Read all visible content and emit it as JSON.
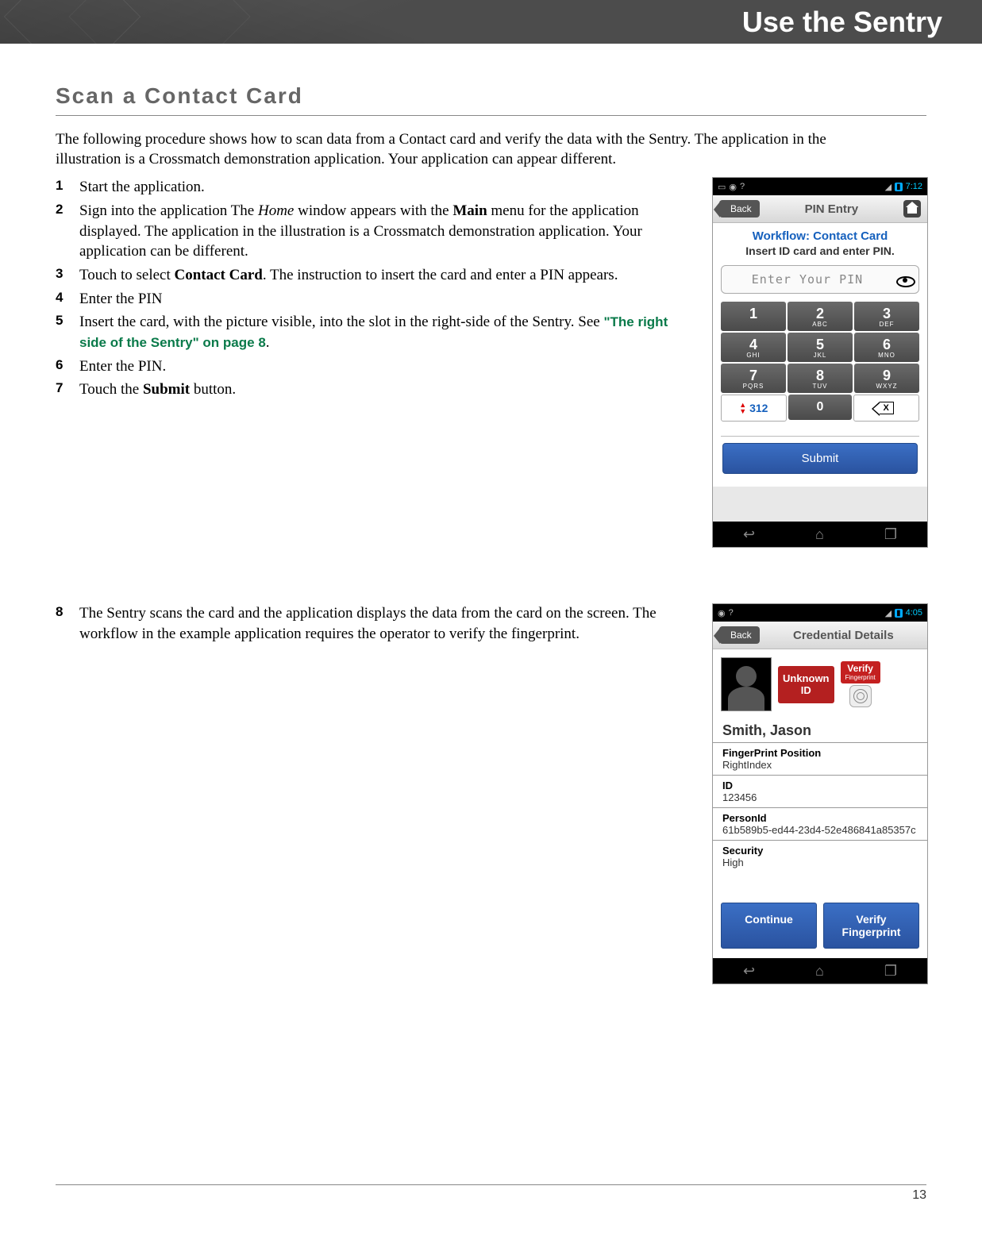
{
  "header": {
    "title": "Use the Sentry"
  },
  "section_title": "Scan a Contact Card",
  "intro": "The following procedure shows how to scan data from a Contact card and verify the data with the Sentry. The application in the illustration is a Crossmatch demonstration application. Your application can appear different.",
  "steps": {
    "s1": {
      "n": "1",
      "text": "Start the application."
    },
    "s2": {
      "n": "2",
      "pre": "Sign into the application The ",
      "home": "Home",
      "mid": " window appears with the ",
      "main": "Main",
      "post": " menu for the application displayed. The application in the illustration is a Crossmatch demonstration application. Your application can be different."
    },
    "s3": {
      "n": "3",
      "pre": "Touch to select ",
      "bold": "Contact Card",
      "post": ". The instruction to insert the card and enter a PIN appears."
    },
    "s4": {
      "n": "4",
      "text": "Enter the PIN"
    },
    "s5": {
      "n": "5",
      "pre": "Insert the card, with the picture visible, into the slot in the right-side of the Sentry. See ",
      "link": "\"The right side of the Sentry\" on page 8",
      "post": "."
    },
    "s6": {
      "n": "6",
      "text": "Enter the PIN."
    },
    "s7": {
      "n": "7",
      "pre": "Touch the ",
      "bold": "Submit",
      "post": " button."
    },
    "s8": {
      "n": "8",
      "text": "The Sentry scans the card and the application displays the data from the card on the screen. The workflow in the example application requires the operator to verify the fingerprint."
    }
  },
  "pin_screen": {
    "time": "7:12",
    "back": "Back",
    "title": "PIN Entry",
    "workflow": "Workflow: Contact Card",
    "instruction": "Insert ID card and enter PIN.",
    "placeholder": "Enter Your PIN",
    "keys": [
      {
        "d": "1",
        "l": ""
      },
      {
        "d": "2",
        "l": "ABC"
      },
      {
        "d": "3",
        "l": "DEF"
      },
      {
        "d": "4",
        "l": "GHI"
      },
      {
        "d": "5",
        "l": "JKL"
      },
      {
        "d": "6",
        "l": "MNO"
      },
      {
        "d": "7",
        "l": "PQRS"
      },
      {
        "d": "8",
        "l": "TUV"
      },
      {
        "d": "9",
        "l": "WXYZ"
      }
    ],
    "lang": "312",
    "zero": "0",
    "del": "X",
    "submit": "Submit"
  },
  "cred_screen": {
    "time": "4:05",
    "back": "Back",
    "title": "Credential Details",
    "unknown1": "Unknown",
    "unknown2": "ID",
    "verify": "Verify",
    "verify_sub": "Fingerprint",
    "name": "Smith, Jason",
    "fields": [
      {
        "label": "FingerPrint Position",
        "value": "RightIndex"
      },
      {
        "label": "ID",
        "value": "123456"
      },
      {
        "label": "PersonId",
        "value": "61b589b5-ed44-23d4-52e486841a85357c"
      },
      {
        "label": "Security",
        "value": "High"
      }
    ],
    "continue": "Continue",
    "verify_fp": "Verify Fingerprint"
  },
  "page_number": "13"
}
